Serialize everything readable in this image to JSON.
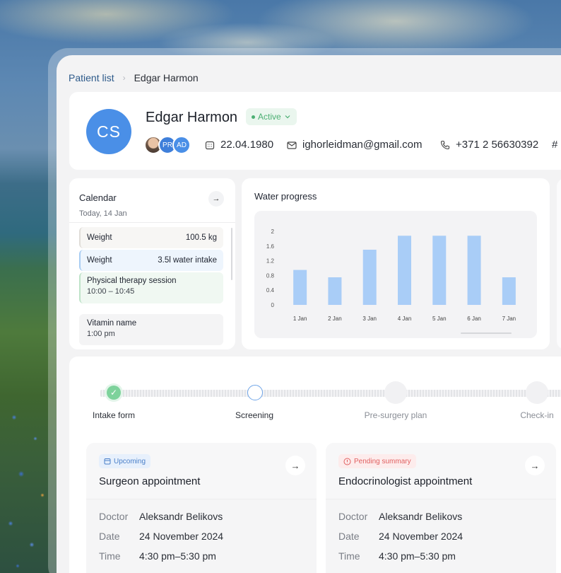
{
  "breadcrumb": {
    "parent": "Patient list",
    "current": "Edgar Harmon"
  },
  "patient": {
    "initials": "CS",
    "name": "Edgar Harmon",
    "status": "Active",
    "team": [
      "PR",
      "AD"
    ],
    "dob": "22.04.1980",
    "email": "ighorleidman@gmail.com",
    "phone": "+371 2 56630392",
    "extra_icon": "#"
  },
  "calendar": {
    "title": "Calendar",
    "today": "Today, 14 Jan",
    "events": [
      {
        "label": "Weight",
        "value": "100.5 kg"
      },
      {
        "label": "Weight",
        "value": "3.5l water intake"
      },
      {
        "label": "Physical therapy session",
        "value": "10:00 – 10:45"
      },
      {
        "label": "Vitamin name",
        "value": "1:00 pm"
      }
    ]
  },
  "chart_data": {
    "type": "bar",
    "title": "Water progress",
    "categories": [
      "1 Jan",
      "2 Jan",
      "3 Jan",
      "4 Jan",
      "5 Jan",
      "6 Jan",
      "7 Jan"
    ],
    "values": [
      0.95,
      0.75,
      1.5,
      1.88,
      1.88,
      1.88,
      0.75
    ],
    "yticks": [
      "0",
      "0.4",
      "0.8",
      "1.2",
      "1.6",
      "2"
    ],
    "ylim": [
      0,
      2
    ],
    "color": "#a9cdf7"
  },
  "journey": {
    "steps": [
      {
        "label": "Intake form",
        "state": "done"
      },
      {
        "label": "Screening",
        "state": "current"
      },
      {
        "label": "Pre-surgery plan",
        "state": "todo"
      },
      {
        "label": "Check-in",
        "state": "todo"
      }
    ]
  },
  "appointments": [
    {
      "tag": "Upcoming",
      "title": "Surgeon appointment",
      "doctor_label": "Doctor",
      "doctor": "Aleksandr Belikovs",
      "date_label": "Date",
      "date": "24 November 2024",
      "time_label": "Time",
      "time": "4:30 pm–5:30 pm"
    },
    {
      "tag": "Pending summary",
      "title": "Endocrinologist  appointment",
      "doctor_label": "Doctor",
      "doctor": "Aleksandr Belikovs",
      "date_label": "Date",
      "date": "24 November 2024",
      "time_label": "Time",
      "time": "4:30 pm–5:30 pm"
    }
  ]
}
